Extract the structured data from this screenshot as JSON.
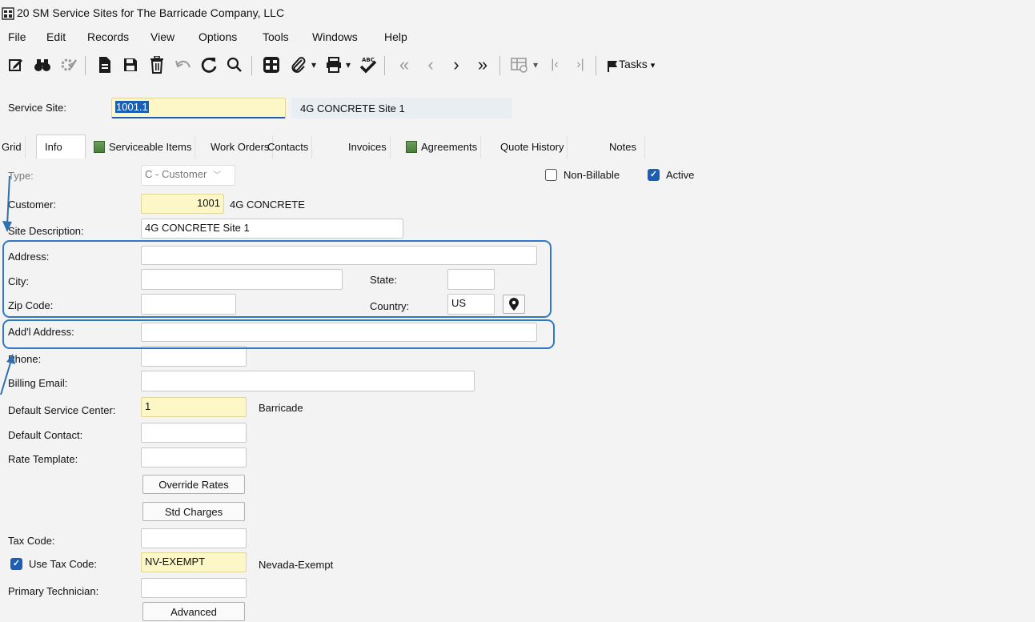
{
  "window": {
    "title": "20 SM Service Sites for The Barricade Company, LLC"
  },
  "menu": [
    "File",
    "Edit",
    "Records",
    "View",
    "Options",
    "Tools",
    "Windows",
    "Help"
  ],
  "toolbar": {
    "tasks_label": "Tasks"
  },
  "header": {
    "service_site_label": "Service Site:",
    "service_site_value": "1001.1",
    "service_site_desc": "4G CONCRETE Site 1"
  },
  "tabs": [
    "Grid",
    "Info",
    "Serviceable Items",
    "Work Orders",
    "Contacts",
    "Invoices",
    "Agreements",
    "Quote History",
    "Notes"
  ],
  "form": {
    "type_label": "Type:",
    "type_value": "C - Customer",
    "non_billable_label": "Non-Billable",
    "active_label": "Active",
    "customer_label": "Customer:",
    "customer_value": "1001",
    "customer_name": "4G CONCRETE",
    "site_desc_label": "Site Description:",
    "site_desc_value": "4G CONCRETE Site 1",
    "address_label": "Address:",
    "city_label": "City:",
    "state_label": "State:",
    "zip_label": "Zip Code:",
    "country_label": "Country:",
    "country_value": "US",
    "addl_address_label": "Add'l Address:",
    "phone_label": "Phone:",
    "billing_email_label": "Billing Email:",
    "default_service_center_label": "Default Service Center:",
    "default_service_center_value": "1",
    "default_service_center_name": "Barricade",
    "default_contact_label": "Default Contact:",
    "rate_template_label": "Rate Template:",
    "override_rates_label": "Override Rates",
    "std_charges_label": "Std Charges",
    "tax_code_label": "Tax Code:",
    "use_tax_code_label": "Use Tax Code:",
    "use_tax_code_value": "NV-EXEMPT",
    "use_tax_code_desc": "Nevada-Exempt",
    "primary_technician_label": "Primary Technician:",
    "advanced_label": "Advanced"
  },
  "colors": {
    "highlight": "#2f78c4",
    "required_field": "#fdf6c6",
    "checkbox_checked": "#1a5fb4"
  }
}
